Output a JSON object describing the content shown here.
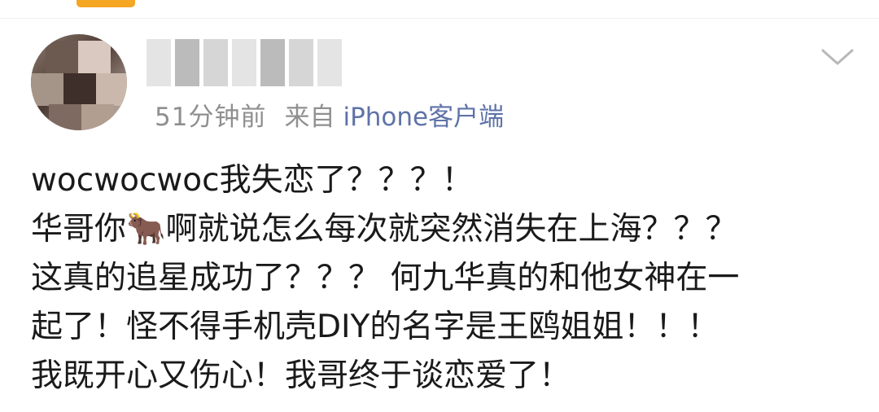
{
  "post_header": {
    "time": "51分钟前",
    "source": "来自",
    "device": "iPhone客户端"
  },
  "content": {
    "lines": [
      "wocwocwoc我失恋了？？？！",
      "华哥你🐂啊就说怎么每次就突然消失在上海？？？",
      "这真的追星成功了？？？ 何九华真的和他女神在一",
      "起了！怪不得手机壳DIY的名字是王鸥姐姐！！！",
      "我既开心又伤心！我哥终于谈恋爱了！"
    ]
  },
  "icons": {
    "more": "chevron-down-icon"
  },
  "colors": {
    "accent": "#f5a623",
    "meta_text": "#8f8f8f",
    "device_text": "#5f73a8",
    "body_text": "#1a1a1a"
  }
}
